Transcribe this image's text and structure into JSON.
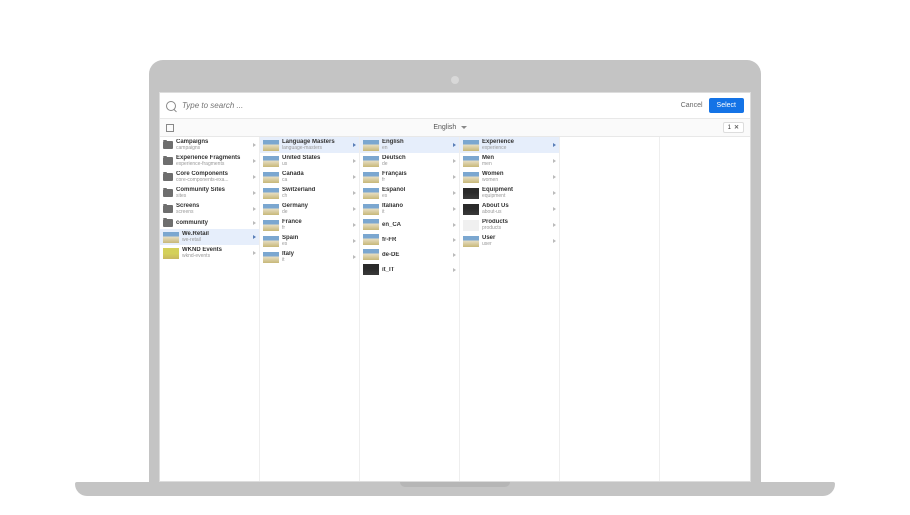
{
  "search": {
    "placeholder": "Type to search ..."
  },
  "actions": {
    "cancel": "Cancel",
    "select": "Select"
  },
  "subbar": {
    "language": "English",
    "count": "1",
    "close": "✕"
  },
  "columns": [
    {
      "items": [
        {
          "icon": "fold",
          "t1": "Campaigns",
          "t2": "campaigns",
          "sel": false
        },
        {
          "icon": "fold",
          "t1": "Experience Fragments",
          "t2": "experience-fragments",
          "sel": false
        },
        {
          "icon": "fold",
          "t1": "Core Components",
          "t2": "core-components-exa...",
          "sel": false
        },
        {
          "icon": "fold",
          "t1": "Community Sites",
          "t2": "sites",
          "sel": false
        },
        {
          "icon": "fold",
          "t1": "Screens",
          "t2": "screens",
          "sel": false
        },
        {
          "icon": "fold",
          "t1": "community",
          "t2": "",
          "sel": false
        },
        {
          "icon": "th",
          "t1": "We.Retail",
          "t2": "we-retail",
          "sel": true
        },
        {
          "icon": "yl",
          "t1": "WKND Events",
          "t2": "wknd-events",
          "sel": false
        }
      ]
    },
    {
      "items": [
        {
          "icon": "th",
          "t1": "Language Masters",
          "t2": "language-masters",
          "sel": true
        },
        {
          "icon": "th",
          "t1": "United States",
          "t2": "us",
          "sel": false
        },
        {
          "icon": "th",
          "t1": "Canada",
          "t2": "ca",
          "sel": false
        },
        {
          "icon": "th",
          "t1": "Switzerland",
          "t2": "ch",
          "sel": false
        },
        {
          "icon": "th",
          "t1": "Germany",
          "t2": "de",
          "sel": false
        },
        {
          "icon": "th",
          "t1": "France",
          "t2": "fr",
          "sel": false
        },
        {
          "icon": "th",
          "t1": "Spain",
          "t2": "es",
          "sel": false
        },
        {
          "icon": "th",
          "t1": "Italy",
          "t2": "it",
          "sel": false
        }
      ]
    },
    {
      "items": [
        {
          "icon": "th",
          "t1": "English",
          "t2": "en",
          "sel": true
        },
        {
          "icon": "th",
          "t1": "Deutsch",
          "t2": "de",
          "sel": false
        },
        {
          "icon": "th",
          "t1": "Français",
          "t2": "fr",
          "sel": false
        },
        {
          "icon": "th",
          "t1": "Español",
          "t2": "es",
          "sel": false
        },
        {
          "icon": "th",
          "t1": "Italiano",
          "t2": "it",
          "sel": false
        },
        {
          "icon": "th",
          "t1": "en_CA",
          "t2": "",
          "sel": false
        },
        {
          "icon": "th",
          "t1": "fr-FR",
          "t2": "",
          "sel": false
        },
        {
          "icon": "th",
          "t1": "de-DE",
          "t2": "",
          "sel": false
        },
        {
          "icon": "dk",
          "t1": "it_IT",
          "t2": "",
          "sel": false
        }
      ]
    },
    {
      "items": [
        {
          "icon": "th",
          "t1": "Experience",
          "t2": "experience",
          "sel": true
        },
        {
          "icon": "th",
          "t1": "Men",
          "t2": "men",
          "sel": false
        },
        {
          "icon": "th",
          "t1": "Women",
          "t2": "women",
          "sel": false
        },
        {
          "icon": "dk",
          "t1": "Equipment",
          "t2": "equipment",
          "sel": false
        },
        {
          "icon": "dk",
          "t1": "About Us",
          "t2": "about-us",
          "sel": false
        },
        {
          "icon": "wt",
          "t1": "Products",
          "t2": "products",
          "sel": false
        },
        {
          "icon": "th",
          "t1": "User",
          "t2": "user",
          "sel": false
        }
      ]
    },
    {
      "items": []
    }
  ]
}
